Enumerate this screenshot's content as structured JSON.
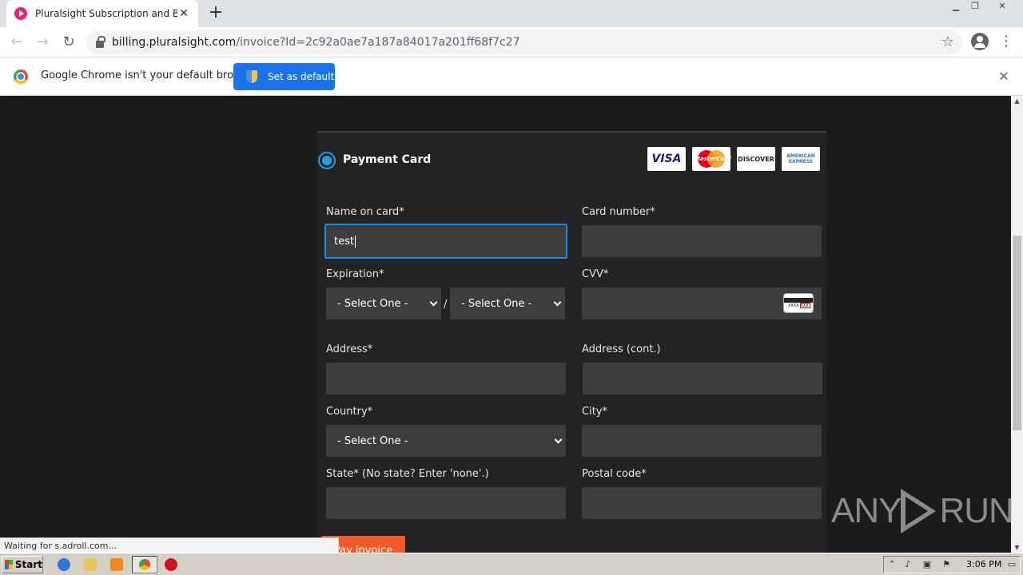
{
  "browser": {
    "tab_title": "Pluralsight Subscription and Billing",
    "tab_close": "✕",
    "new_tab": "+",
    "url_domain": "billing.pluralsight.com",
    "url_path": "/invoice?Id=2c92a0ae7a187a84017a201ff68f7c27",
    "window_controls": [
      "minimize-icon",
      "restore-icon",
      "close-icon"
    ]
  },
  "infobar": {
    "message": "Google Chrome isn't your default browser",
    "button": "Set as default",
    "close": "✕"
  },
  "payment": {
    "section_title": "Payment Card",
    "card_brands": [
      "VISA",
      "MasterCard",
      "DISCOVER",
      "AMERICAN EXPRESS"
    ],
    "fields": {
      "name_label": "Name on card*",
      "name_value": "test",
      "card_number_label": "Card number*",
      "card_number_value": "",
      "expiration_label": "Expiration*",
      "exp_month": "- Select One -",
      "exp_year": "- Select One -",
      "exp_separator": "/",
      "cvv_label": "CVV*",
      "cvv_value": "",
      "cvv_card_text": "XXXX XXX",
      "address_label": "Address*",
      "address_value": "",
      "address2_label": "Address (cont.)",
      "address2_value": "",
      "country_label": "Country*",
      "country_value": "- Select One -",
      "city_label": "City*",
      "city_value": "",
      "state_label": "State* (No state? Enter 'none'.)",
      "state_value": "",
      "postal_label": "Postal code*",
      "postal_value": ""
    },
    "pay_button": "Pay invoice"
  },
  "status_bar": "Waiting for s.adroll.com...",
  "watermark": {
    "left": "ANY",
    "right": "RUN"
  },
  "taskbar": {
    "start": "Start",
    "clock": "3:06 PM",
    "pinned": [
      "ie-icon",
      "explorer-icon",
      "media-player-icon",
      "chrome-icon",
      "opera-icon"
    ]
  },
  "colors": {
    "page_bg": "#1b1b1b",
    "card_bg": "#232323",
    "input_bg": "#3d3d3d",
    "focus_border": "#1b8ae3",
    "accent_radio": "#1ba0e8",
    "pay_button": "#f15b2a",
    "chrome_blue": "#1a73e8"
  }
}
